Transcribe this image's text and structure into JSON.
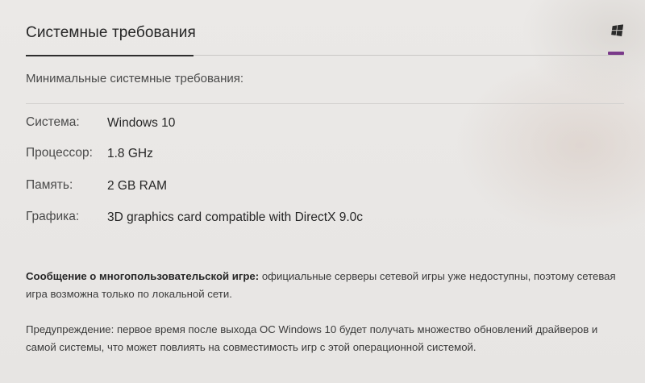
{
  "section": {
    "title": "Системные требования",
    "os_tab_icon": "windows-icon",
    "accent_color": "#7a3a8a"
  },
  "requirements": {
    "subtitle": "Минимальные системные требования:",
    "rows": [
      {
        "label": "Система:",
        "value": "Windows 10"
      },
      {
        "label": "Процессор:",
        "value": "1.8 GHz"
      },
      {
        "label": "Память:",
        "value": "2 GB RAM"
      },
      {
        "label": "Графика:",
        "value": "3D graphics card compatible with DirectX 9.0c"
      }
    ]
  },
  "notes": {
    "multiplayer_bold": "Сообщение о многопользовательской игре:",
    "multiplayer_text": " официальные серверы сетевой игры уже недоступны, поэтому сетевая игра возможна только по локальной сети.",
    "warning_text": "Предупреждение: первое время после выхода ОС Windows 10 будет получать множество обновлений драйверов и самой системы, что может повлиять на совместимость игр с этой операционной системой."
  }
}
